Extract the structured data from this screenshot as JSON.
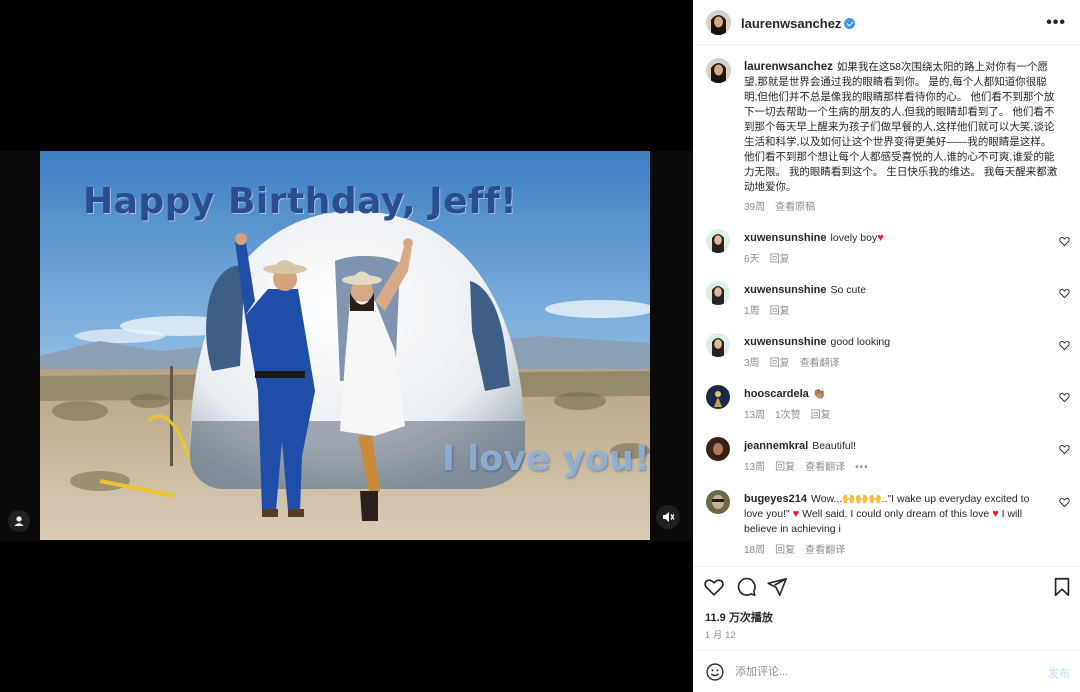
{
  "media": {
    "overlay_title": "Happy Birthday, Jeff!",
    "overlay_subtitle": "I love you!"
  },
  "post": {
    "username": "laurenwsanchez",
    "caption": "如果我在这58次围绕太阳的路上对你有一个愿望,那就是世界会通过我的眼睛看到你。 是的,每个人都知道你很聪明,但他们并不总是像我的眼睛那样看待你的心。 他们看不到那个放下一切去帮助一个生病的朋友的人,但我的眼睛却看到了。 他们看不到那个每天早上醒来为孩子们做早餐的人,这样他们就可以大笑,谈论生活和科学,以及如何让这个世界变得更美好——我的眼睛是这样。 他们看不到那个想让每个人都感受喜悦的人,谁的心不可爽,谁爱的能力无限。 我的眼睛看到这个。 生日快乐我的维达。 我每天醒来都激动地爱你。",
    "caption_time": "39周",
    "caption_see_translation": "查看原稿"
  },
  "comments": [
    {
      "username": "xuwensunshine",
      "text": "lovely boy",
      "emoji": "♥",
      "time": "6天",
      "reply": "回复",
      "likes": "",
      "translate": ""
    },
    {
      "username": "xuwensunshine",
      "text": "So cute",
      "emoji": "",
      "time": "1周",
      "reply": "回复",
      "likes": "",
      "translate": ""
    },
    {
      "username": "xuwensunshine",
      "text": "good looking",
      "emoji": "",
      "time": "3周",
      "reply": "回复",
      "likes": "",
      "translate": "查看翻译"
    },
    {
      "username": "hooscardela",
      "text": "",
      "emoji": "👏🏽",
      "time": "13周",
      "reply": "回复",
      "likes": "1次赞",
      "translate": ""
    },
    {
      "username": "jeannemkral",
      "text": "Beautiful!",
      "emoji": "",
      "time": "13周",
      "reply": "回复",
      "likes": "",
      "translate": "查看翻译"
    },
    {
      "username": "bugeyes214",
      "text_a": "Wow...",
      "emoji_a": "🙌🙌🙌",
      "text_b": "..\"I wake up everyday excited to love you!\" ",
      "emoji_b": "♥",
      "text_c": " Well said. I could only dream of this love ",
      "emoji_c": "♥",
      "text_d": " I will believe in achieving i",
      "time": "18周",
      "reply": "回复",
      "translate": "查看翻译"
    }
  ],
  "actions": {
    "views": "11.9 万次播放",
    "date": "1 月 12",
    "comment_placeholder": "添加评论...",
    "post_label": "发布"
  },
  "header": {
    "more": "•••"
  },
  "colors": {
    "verified": "#3897f0",
    "heart": "#ed1c3b",
    "post_disabled": "#b2dffc",
    "muted_text": "#8e8e8e"
  }
}
